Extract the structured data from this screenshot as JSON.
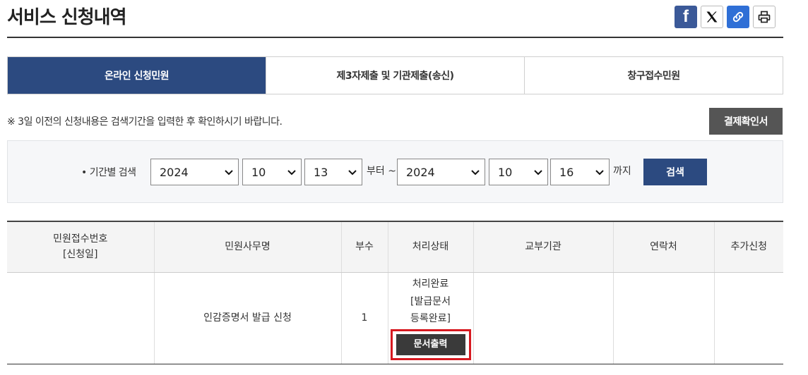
{
  "header": {
    "title": "서비스 신청내역"
  },
  "share": {
    "facebook_glyph": "f",
    "facebook_color": "#3b5998",
    "link_color": "#2f6fd6"
  },
  "tabs": [
    {
      "label": "온라인 신청민원",
      "active": true
    },
    {
      "label": "제3자제출 및 기관제출(송신)",
      "active": false
    },
    {
      "label": "창구접수민원",
      "active": false
    }
  ],
  "notice": "※ 3일 이전의 신청내용은 검색기간을 입력한 후 확인하시기 바랍니다.",
  "payment_button": "결제확인서",
  "search": {
    "label": "• 기간별 검색",
    "from": {
      "year": "2024",
      "month": "10",
      "day": "13"
    },
    "from_suffix": "부터 ~",
    "to": {
      "year": "2024",
      "month": "10",
      "day": "16"
    },
    "to_suffix": "까지",
    "button": "검색"
  },
  "table": {
    "headers": {
      "receipt_no": "민원접수번호",
      "receipt_date": "[신청일]",
      "service_name": "민원사무명",
      "copies": "부수",
      "status": "처리상태",
      "issuing_agency": "교부기관",
      "contact": "연락처",
      "additional": "추가신청"
    },
    "rows": [
      {
        "receipt_no": "",
        "service_name": "인감증명서 발급 신청",
        "copies": "1",
        "status_line1": "처리완료",
        "status_line2": "[발급문서",
        "status_line3": "등록완료]",
        "print_button": "문서출력",
        "issuing_agency": "",
        "contact": "",
        "additional": ""
      }
    ]
  },
  "colors": {
    "primary": "#2c4a80",
    "highlight": "#d71920",
    "dark_button": "#3a3a3a"
  }
}
